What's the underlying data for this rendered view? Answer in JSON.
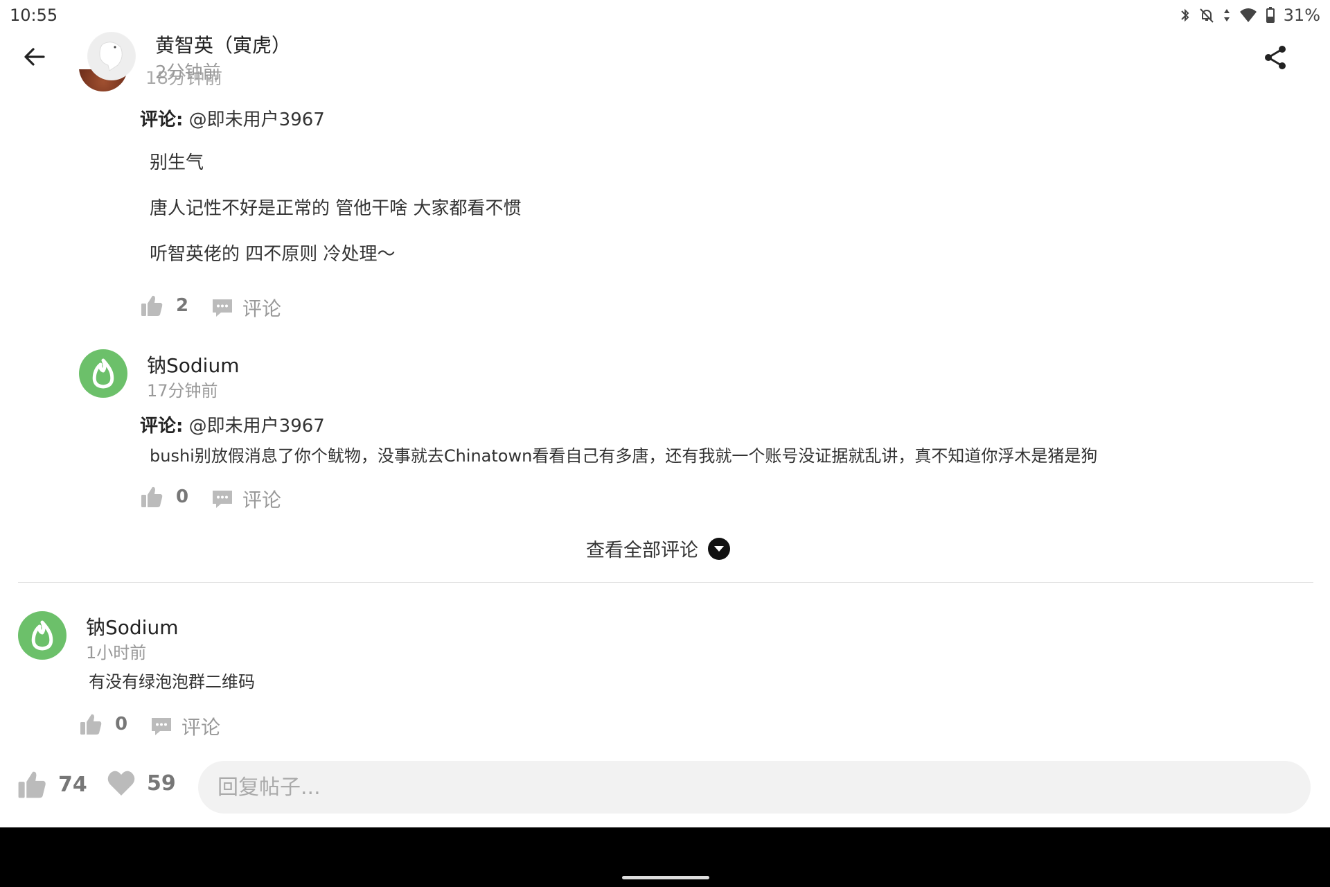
{
  "status_bar": {
    "time": "10:55",
    "battery": "31%",
    "icons": [
      "bluetooth-icon",
      "notifications-off-icon",
      "data-arrows-icon",
      "wifi-icon",
      "battery-icon"
    ]
  },
  "header": {
    "name": "黄智英（寅虎）",
    "time": "2分钟前",
    "back_icon": "arrow-left-icon",
    "share_icon": "share-icon"
  },
  "clipped_above": {
    "time": "18分钟前"
  },
  "replies": [
    {
      "comment_prefix": "评论:",
      "mention": "@即未用户3967",
      "lines": [
        "别生气",
        "唐人记性不好是正常的 管他干啥 大家都看不惯",
        "听智英佬的 四不原则 冷处理～"
      ],
      "likes": "2",
      "comment_label": "评论"
    },
    {
      "author": "钠Sodium",
      "time": "17分钟前",
      "comment_prefix": "评论:",
      "mention": "@即未用户3967",
      "lines": [
        "bushi别放假消息了你个鱿物，没事就去Chinatown看看自己有多唐，还有我就一个账号没证据就乱讲，真不知道你浮木是猪是狗"
      ],
      "likes": "0",
      "comment_label": "评论"
    }
  ],
  "view_all": {
    "label": "查看全部评论"
  },
  "top_comment": {
    "author": "钠Sodium",
    "time": "1小时前",
    "text": "有没有绿泡泡群二维码",
    "likes": "0",
    "comment_label": "评论"
  },
  "bottom_bar": {
    "likes": "74",
    "favorites": "59",
    "reply_placeholder": "回复帖子..."
  },
  "colors": {
    "avatar_green": "#6cc06a",
    "muted_text": "#999999",
    "input_bg": "#f2f2f2"
  }
}
